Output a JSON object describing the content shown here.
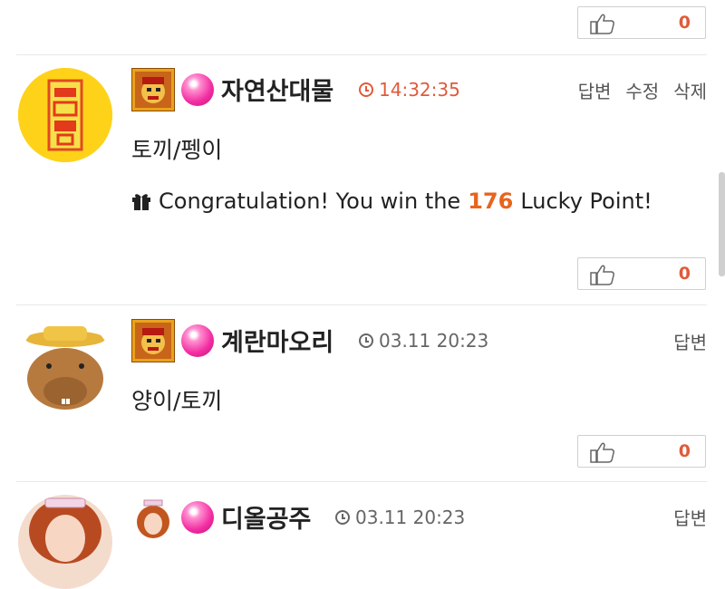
{
  "comments": [
    {
      "nickname": "자연산대물",
      "time": "14:32:35",
      "actions": [
        "답변",
        "수정",
        "삭제"
      ],
      "content": "토끼/펭이",
      "lucky": {
        "prefix": "Congratulation! You win the",
        "points": "176",
        "suffix": "Lucky Point!"
      },
      "likes": "0"
    },
    {
      "nickname": "계란마오리",
      "time": "03.11 20:23",
      "actions": [
        "답변"
      ],
      "content": "양이/토끼",
      "likes": "0"
    },
    {
      "nickname": "디올공주",
      "time": "03.11 20:23",
      "actions": [
        "답변"
      ]
    }
  ],
  "top_like": {
    "count": "0"
  },
  "colors": {
    "accent": "#e05a3a",
    "time_highlight": "#e05a3a",
    "lucky_points": "#e8641e",
    "orb": "#f22ea2"
  },
  "icons": [
    "thumbs-up-icon",
    "clock-icon",
    "gift-icon",
    "level-badge-icon",
    "pink-orb-icon"
  ]
}
